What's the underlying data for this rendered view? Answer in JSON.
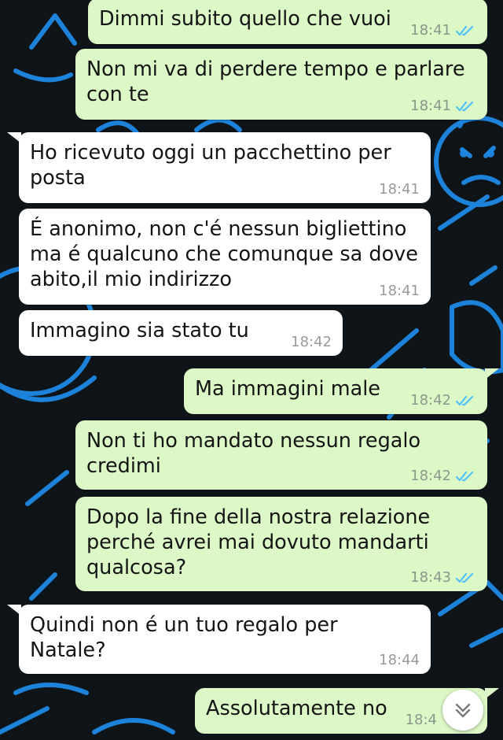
{
  "messages": [
    {
      "text": "Dimmi subito quello che vuoi",
      "time": "18:41",
      "direction": "outgoing",
      "status": "read"
    },
    {
      "text": "Non mi va di perdere tempo e parlare con te",
      "time": "18:41",
      "direction": "outgoing",
      "status": "read"
    },
    {
      "text": "Ho ricevuto oggi un pacchettino per posta",
      "time": "18:41",
      "direction": "incoming"
    },
    {
      "text": "É anonimo, non c'é nessun bigliettino ma é qualcuno che comunque sa dove abito,il mio indirizzo",
      "time": "18:41",
      "direction": "incoming"
    },
    {
      "text": "Immagino sia stato tu",
      "time": "18:42",
      "direction": "incoming"
    },
    {
      "text": "Ma immagini male",
      "time": "18:42",
      "direction": "outgoing",
      "status": "read"
    },
    {
      "text": "Non ti ho mandato nessun regalo credimi",
      "time": "18:42",
      "direction": "outgoing",
      "status": "read"
    },
    {
      "text": "Dopo la fine della nostra relazione perché avrei mai dovuto mandarti qualcosa?",
      "time": "18:43",
      "direction": "outgoing",
      "status": "read"
    },
    {
      "text": "Quindi non é un tuo regalo per Natale?",
      "time": "18:44",
      "direction": "incoming"
    },
    {
      "text": "Assolutamente no",
      "time": "18:4",
      "direction": "outgoing"
    }
  ],
  "scroll_button": {
    "icon": "double-chevron-down-icon"
  },
  "colors": {
    "outgoing_bubble": "#dcf8c6",
    "incoming_bubble": "#ffffff",
    "read_ticks": "#4fc3f7",
    "wallpaper": "#0f1418",
    "wallpaper_doodles": "#1e88e5"
  }
}
